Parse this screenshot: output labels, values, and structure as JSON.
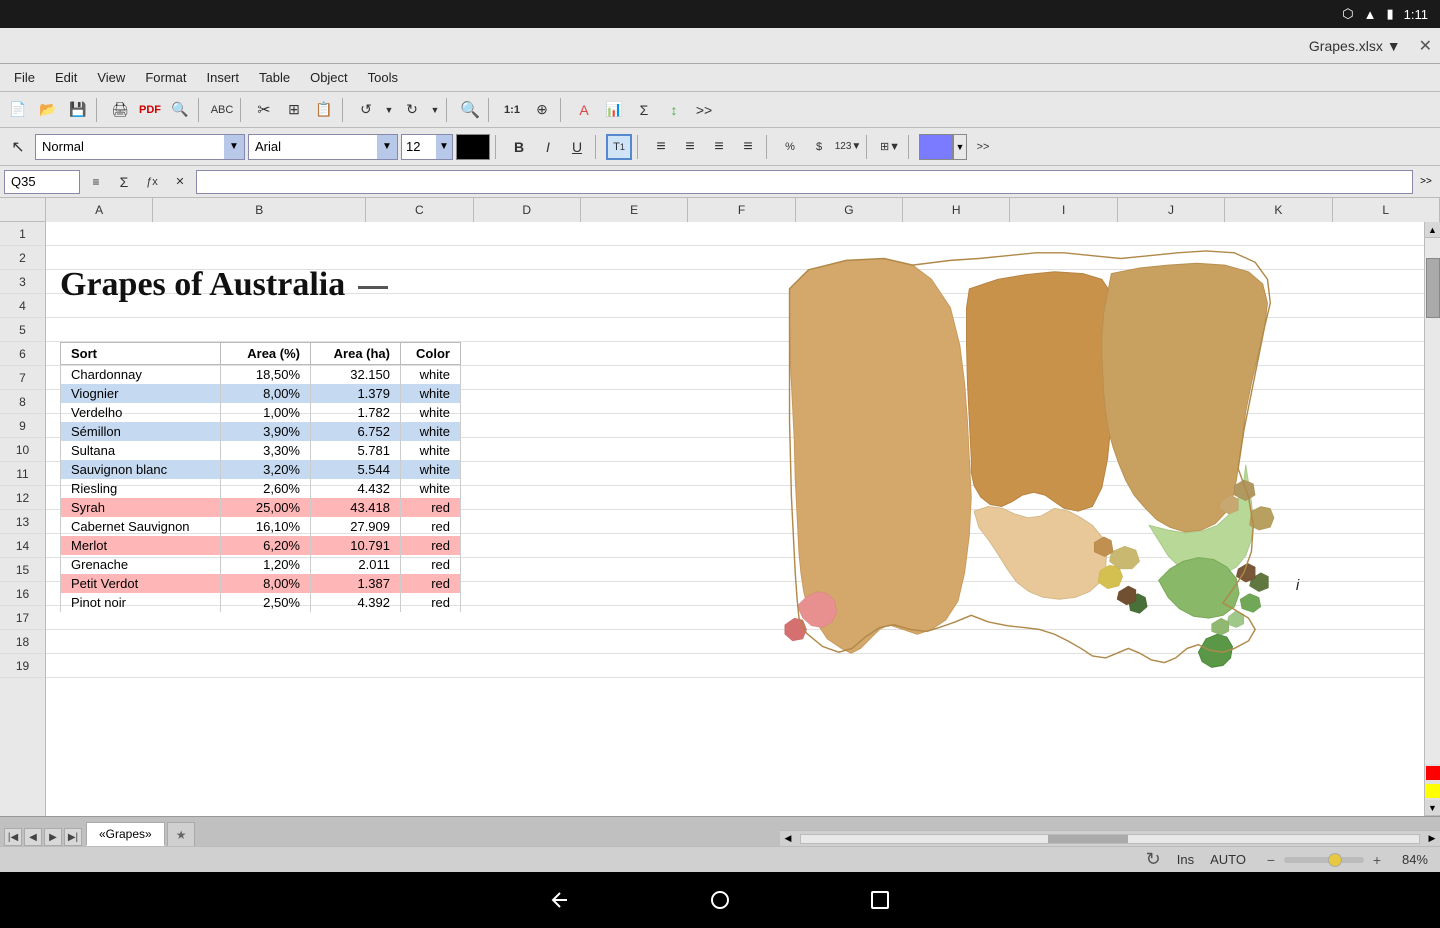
{
  "status_bar": {
    "time": "1:11",
    "icons": [
      "bluetooth",
      "wifi",
      "battery"
    ]
  },
  "title_bar": {
    "filename": "Grapes.xlsx",
    "dropdown_arrow": "▼",
    "close": "✕"
  },
  "menu": {
    "items": [
      "File",
      "Edit",
      "View",
      "Format",
      "Insert",
      "Table",
      "Object",
      "Tools"
    ]
  },
  "toolbar1": {
    "buttons": [
      "new",
      "open",
      "save",
      "print",
      "pdf",
      "preview",
      "spell",
      "cut",
      "copy",
      "paste",
      "undo",
      "redo",
      "find",
      "zoom-fit",
      "zoom-in"
    ]
  },
  "toolbar2": {
    "style": "Normal",
    "font": "Arial",
    "size": "12",
    "bold": "B",
    "italic": "I",
    "underline": "U",
    "text_icon": "T1",
    "align_left": "≡",
    "align_center": "≡",
    "align_right": "≡",
    "align_justify": "≡",
    "percent": "%",
    "currency": "$",
    "accent_color": "#7b7bff",
    "more": ">>"
  },
  "formula_bar": {
    "cell_ref": "Q35",
    "value": ""
  },
  "columns": [
    "A",
    "B",
    "C",
    "D",
    "E",
    "F",
    "G",
    "H",
    "I",
    "J",
    "K",
    "L"
  ],
  "rows": [
    "1",
    "2",
    "3",
    "4",
    "5",
    "6",
    "7",
    "8",
    "9",
    "10",
    "11",
    "12",
    "13",
    "14",
    "15",
    "16",
    "17",
    "18",
    "19"
  ],
  "sheet_title": "Grapes of Australia",
  "table": {
    "headers": [
      "Sort",
      "Area (%)",
      "Area (ha)",
      "Color"
    ],
    "rows": [
      {
        "highlight": "",
        "sort": "Chardonnay",
        "area_pct": "18,50%",
        "area_ha": "32.150",
        "color": "white"
      },
      {
        "highlight": "blue",
        "sort": "Viognier",
        "area_pct": "8,00%",
        "area_ha": "1.379",
        "color": "white"
      },
      {
        "highlight": "",
        "sort": "Verdelho",
        "area_pct": "1,00%",
        "area_ha": "1.782",
        "color": "white"
      },
      {
        "highlight": "blue",
        "sort": "Sémillon",
        "area_pct": "3,90%",
        "area_ha": "6.752",
        "color": "white"
      },
      {
        "highlight": "",
        "sort": "Sultana",
        "area_pct": "3,30%",
        "area_ha": "5.781",
        "color": "white"
      },
      {
        "highlight": "blue",
        "sort": "Sauvignon blanc",
        "area_pct": "3,20%",
        "area_ha": "5.544",
        "color": "white"
      },
      {
        "highlight": "",
        "sort": "Riesling",
        "area_pct": "2,60%",
        "area_ha": "4.432",
        "color": "white"
      },
      {
        "highlight": "pink",
        "sort": "Syrah",
        "area_pct": "25,00%",
        "area_ha": "43.418",
        "color": "red"
      },
      {
        "highlight": "",
        "sort": "Cabernet Sauvignon",
        "area_pct": "16,10%",
        "area_ha": "27.909",
        "color": "red"
      },
      {
        "highlight": "pink",
        "sort": "Merlot",
        "area_pct": "6,20%",
        "area_ha": "10.791",
        "color": "red"
      },
      {
        "highlight": "",
        "sort": "Grenache",
        "area_pct": "1,20%",
        "area_ha": "2.011",
        "color": "red"
      },
      {
        "highlight": "pink",
        "sort": "Petit Verdot",
        "area_pct": "8,00%",
        "area_ha": "1.387",
        "color": "red"
      },
      {
        "highlight": "",
        "sort": "Pinot noir",
        "area_pct": "2,50%",
        "area_ha": "4.392",
        "color": "red"
      }
    ]
  },
  "tabs": {
    "active": "«Grapes»",
    "items": [
      "«Grapes»"
    ],
    "star_tab": "★"
  },
  "status": {
    "ins": "Ins",
    "auto": "AUTO",
    "zoom": "84%"
  },
  "android_nav": {
    "back": "←",
    "home": "○",
    "recents": "□"
  }
}
